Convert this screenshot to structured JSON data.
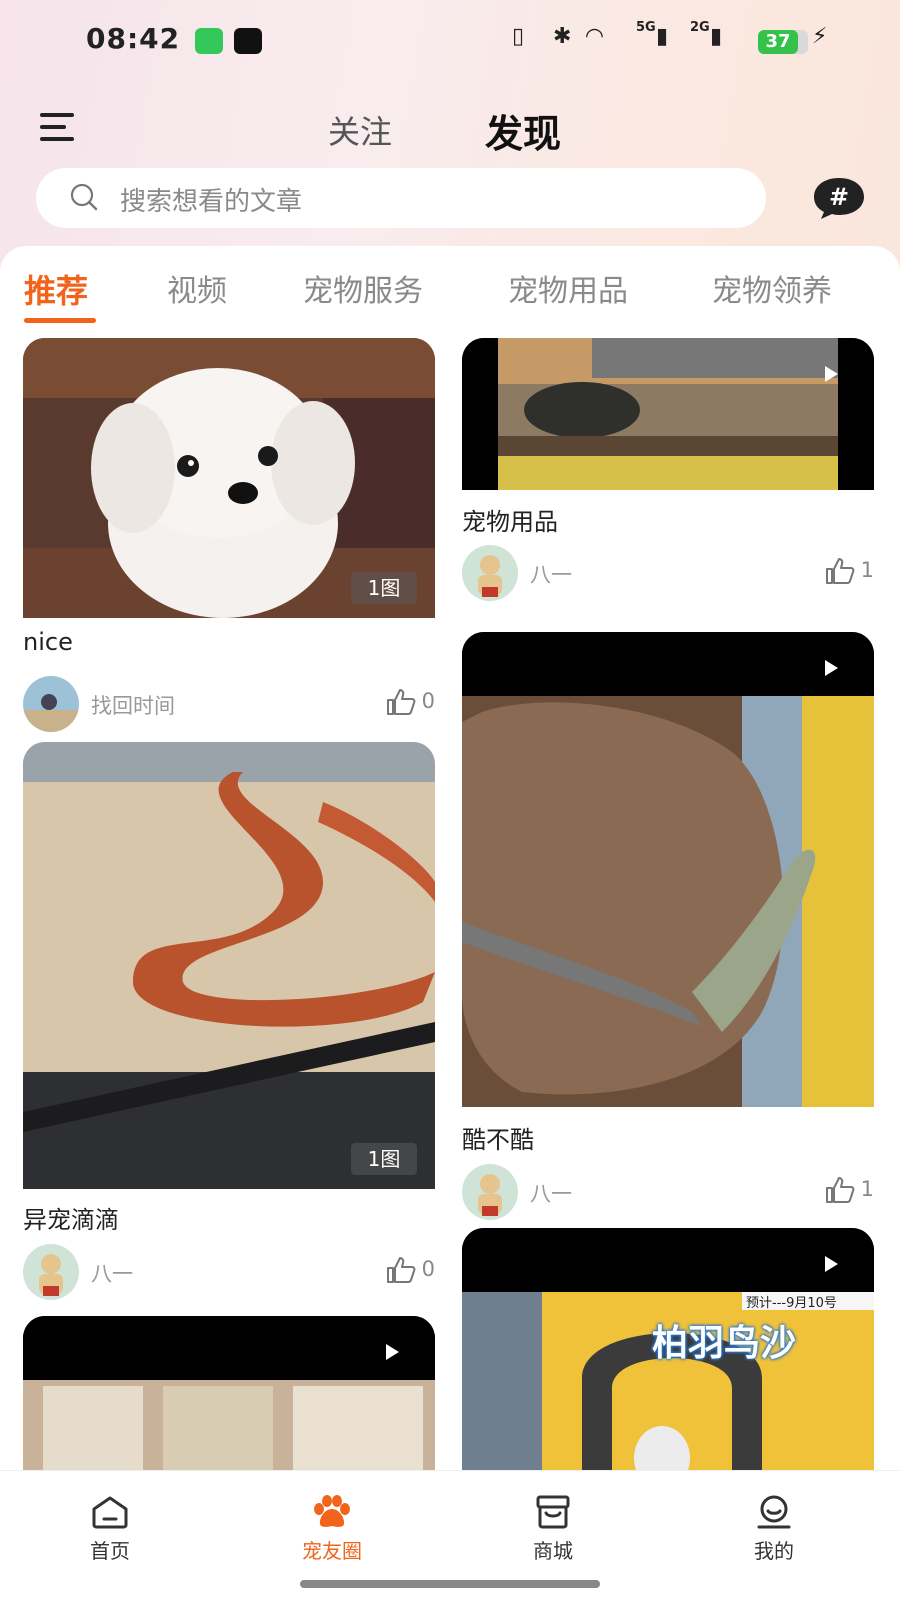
{
  "status_bar": {
    "time": "08:42",
    "battery": "37",
    "net1": "5G",
    "net2": "2G"
  },
  "header": {
    "tab_follow": "关注",
    "tab_discover": "发现"
  },
  "search": {
    "placeholder": "搜索想看的文章"
  },
  "categories": [
    {
      "label": "推荐",
      "active": true
    },
    {
      "label": "视频",
      "active": false
    },
    {
      "label": "宠物服务",
      "active": false
    },
    {
      "label": "宠物用品",
      "active": false
    },
    {
      "label": "宠物领养",
      "active": false
    }
  ],
  "posts": {
    "left": [
      {
        "title": "nice",
        "author": "找回时间",
        "likes": "0",
        "badge": "1图",
        "image": "white-puppy"
      },
      {
        "title": "异宠滴滴",
        "author": "八一",
        "likes": "0",
        "badge": "1图",
        "image": "corn-snake"
      },
      {
        "title": "",
        "author": "",
        "likes": "",
        "badge": "",
        "image": "video-terrarium-boxes"
      }
    ],
    "right": [
      {
        "title": "宠物用品",
        "author": "八一",
        "likes": "1",
        "image": "video-tortoise"
      },
      {
        "title": "酷不酷",
        "author": "八一",
        "likes": "1",
        "image": "video-iguana"
      },
      {
        "title": "",
        "author": "",
        "likes": "",
        "image": "video-bird-shop",
        "overlay_text": "柏羽鸟沙",
        "overlay_sub": "预计---9月10号"
      }
    ]
  },
  "bottom_nav": [
    {
      "label": "首页",
      "icon": "home-icon",
      "active": false
    },
    {
      "label": "宠友圈",
      "icon": "paw-icon",
      "active": true
    },
    {
      "label": "商城",
      "icon": "store-icon",
      "active": false
    },
    {
      "label": "我的",
      "icon": "user-icon",
      "active": false
    }
  ],
  "colors": {
    "accent": "#f2641c",
    "text": "#222222",
    "muted": "#999999"
  }
}
